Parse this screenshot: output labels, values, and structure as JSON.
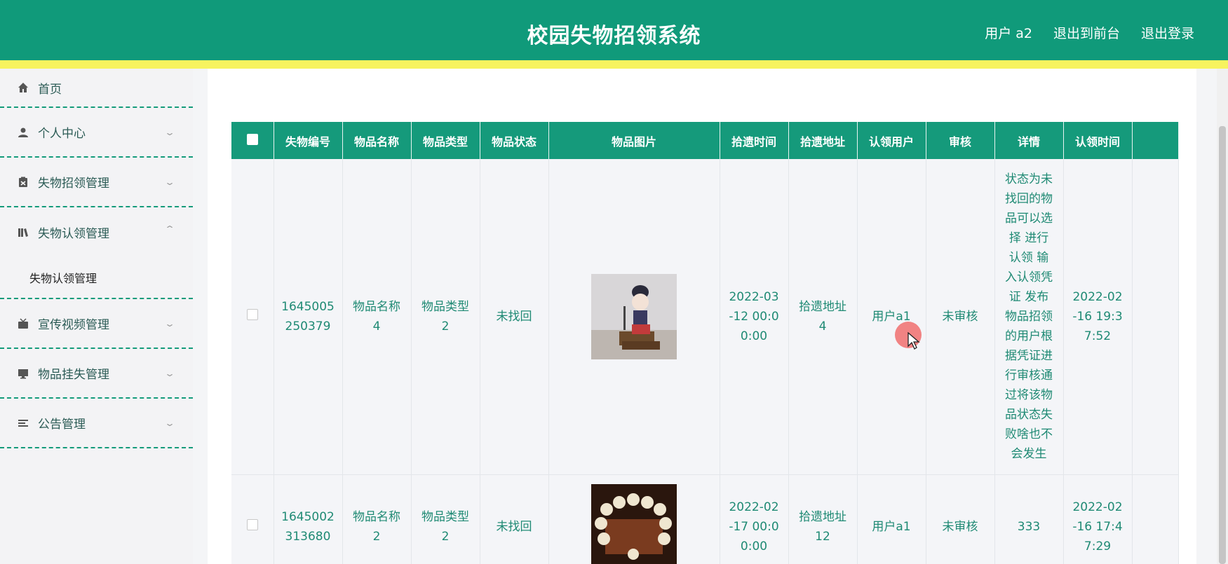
{
  "header": {
    "title": "校园失物招领系统",
    "links": [
      "用户 a2",
      "退出到前台",
      "退出登录"
    ]
  },
  "sidebar": {
    "items": [
      {
        "label": "首页",
        "icon": "home-icon"
      },
      {
        "label": "个人中心",
        "icon": "user-icon"
      },
      {
        "label": "失物招领管理",
        "icon": "clipboard-icon"
      },
      {
        "label": "失物认领管理",
        "icon": "book-icon",
        "expanded": true
      },
      {
        "label": "宣传视频管理",
        "icon": "video-icon"
      },
      {
        "label": "物品挂失管理",
        "icon": "monitor-icon"
      },
      {
        "label": "公告管理",
        "icon": "list-icon"
      }
    ],
    "submenu_label": "失物认领管理"
  },
  "table": {
    "columns": [
      "失物编号",
      "物品名称",
      "物品类型",
      "物品状态",
      "物品图片",
      "拾遗时间",
      "拾遗地址",
      "认领用户",
      "审核",
      "详情",
      "认领时间"
    ],
    "rows": [
      {
        "id": "1645005250379",
        "name": "物品名称4",
        "type": "物品类型2",
        "status": "未找回",
        "image": "figurine-photo",
        "found_time": "2022-03-12 00:00:00",
        "found_addr": "拾遗地址4",
        "user": "用户a1",
        "review": "未审核",
        "detail": "状态为未找回的物品可以选择 进行认领 输入认领凭证 发布物品招领的用户根据凭证进行审核通过将该物品状态失败啥也不会发生",
        "claim_time": "2022-02-16 19:37:52"
      },
      {
        "id": "1645002313680",
        "name": "物品名称2",
        "type": "物品类型2",
        "status": "未找回",
        "image": "bead-bracelet-photo",
        "found_time": "2022-02-17 00:00:00",
        "found_addr": "拾遗地址12",
        "user": "用户a1",
        "review": "未审核",
        "detail": "333",
        "claim_time": "2022-02-16 17:47:29"
      }
    ]
  },
  "colors": {
    "primary": "#109a7a",
    "stripe": "#f7f35f",
    "text_green": "#1f8a74"
  }
}
